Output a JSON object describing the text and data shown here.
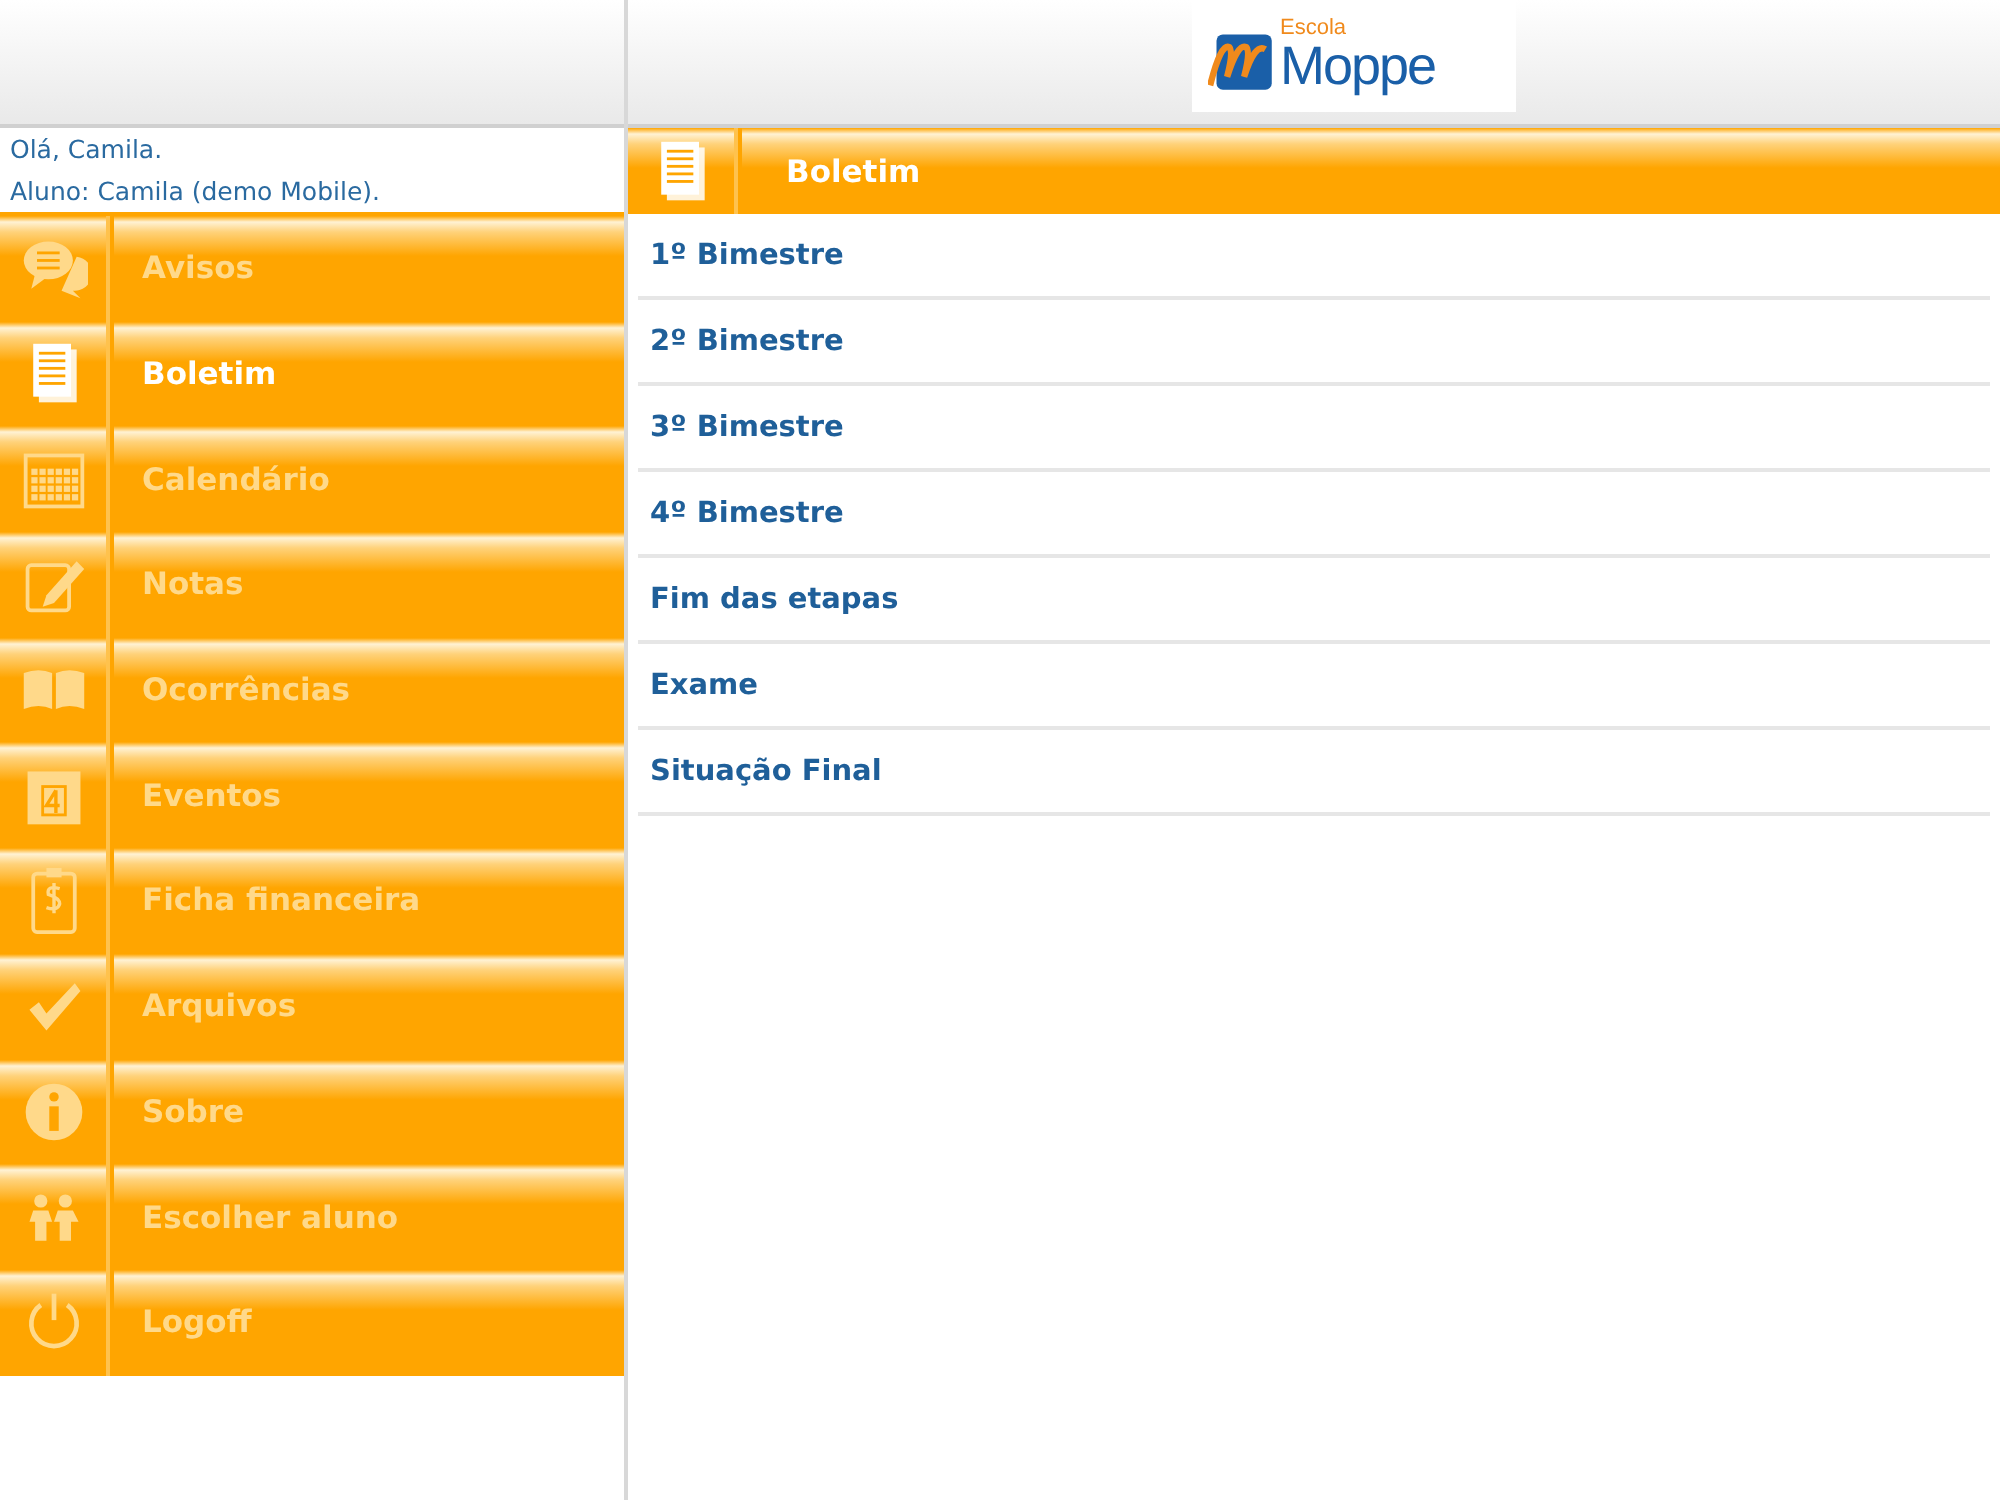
{
  "logo": {
    "small": "Escola",
    "large": "Moppe"
  },
  "greeting": {
    "hello": "Olá, Camila.",
    "student": "Aluno: Camila (demo Mobile)."
  },
  "menu": [
    {
      "label": "Avisos",
      "kind": "chat",
      "selected": false
    },
    {
      "label": "Boletim",
      "kind": "document",
      "selected": true
    },
    {
      "label": "Calendário",
      "kind": "calendar",
      "selected": false
    },
    {
      "label": "Notas",
      "kind": "edit",
      "selected": false
    },
    {
      "label": "Ocorrências",
      "kind": "book",
      "selected": false
    },
    {
      "label": "Eventos",
      "kind": "day",
      "selected": false
    },
    {
      "label": "Ficha financeira",
      "kind": "money",
      "selected": false
    },
    {
      "label": "Arquivos",
      "kind": "check",
      "selected": false
    },
    {
      "label": "Sobre",
      "kind": "info",
      "selected": false
    },
    {
      "label": "Escolher aluno",
      "kind": "people",
      "selected": false
    },
    {
      "label": "Logoff",
      "kind": "power",
      "selected": false
    }
  ],
  "panel": {
    "title": "Boletim",
    "kind": "document"
  },
  "list": [
    "1º Bimestre",
    "2º Bimestre",
    "3º Bimestre",
    "4º Bimestre",
    "Fim das etapas",
    "Exame",
    "Situação Final"
  ]
}
